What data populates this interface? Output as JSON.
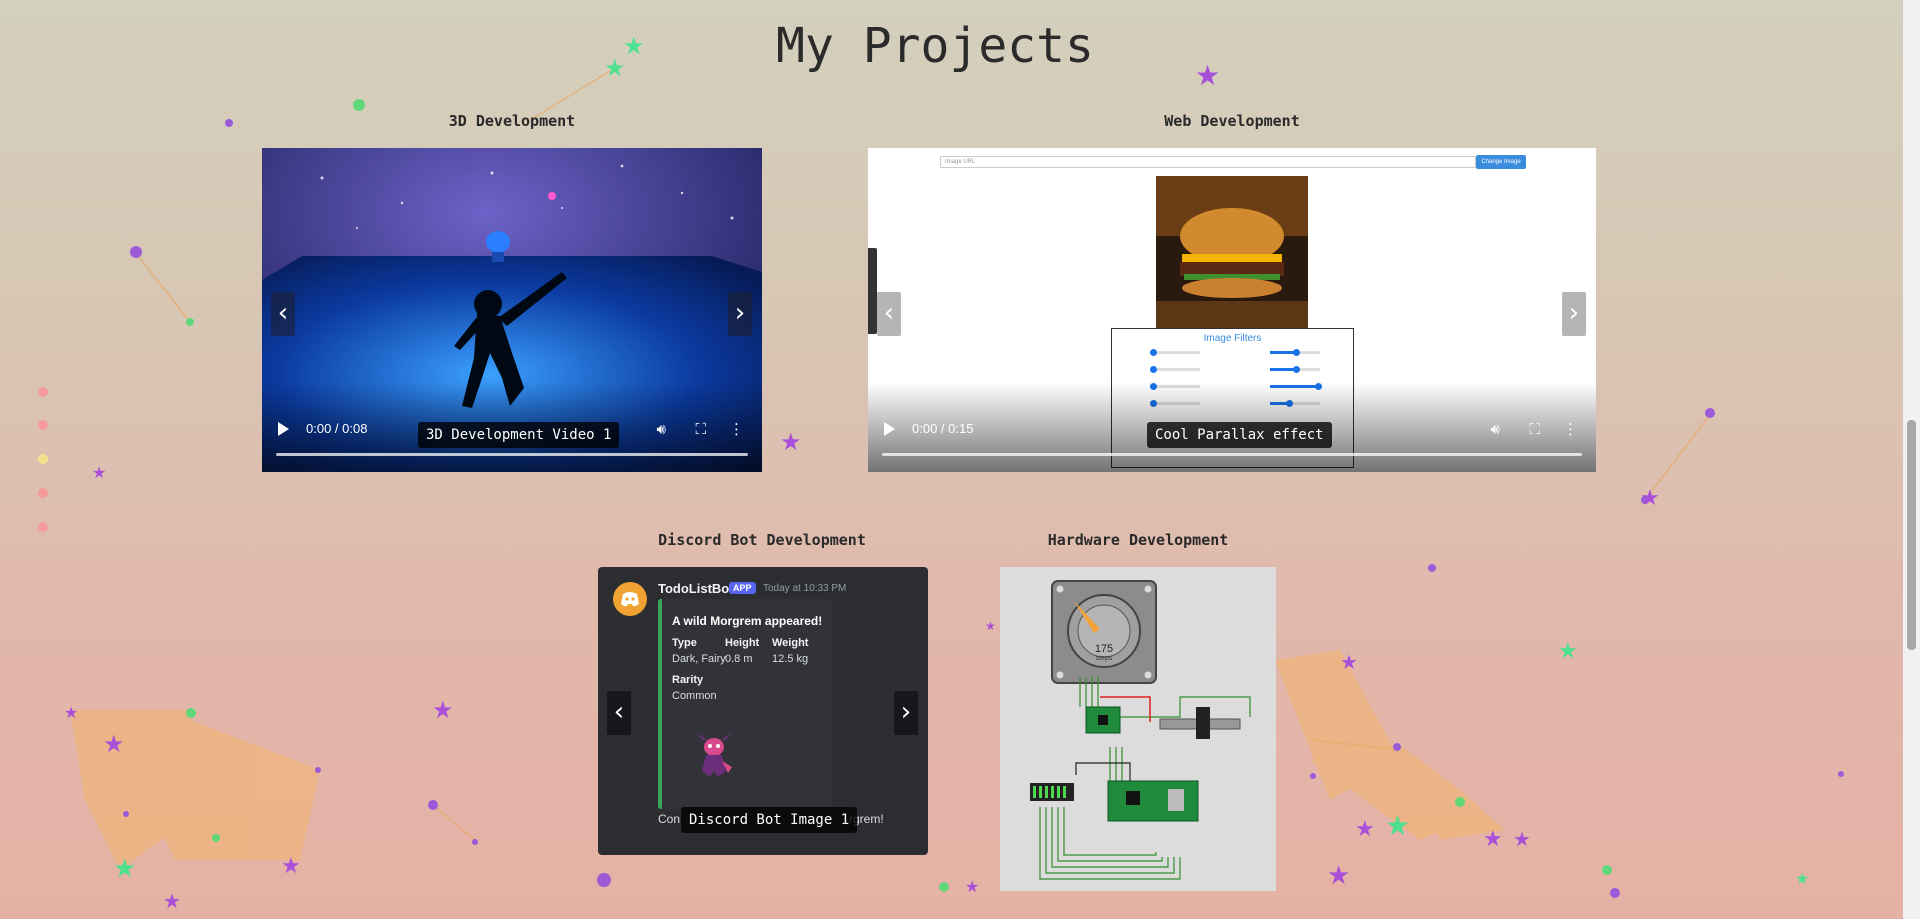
{
  "page": {
    "title": "My Projects"
  },
  "sections": {
    "dev3d": {
      "label": "3D Development",
      "caption": "3D Development Video 1",
      "time": "0:00 / 0:08"
    },
    "web": {
      "label": "Web Development",
      "caption": "Cool Parallax effect",
      "time": "0:00 / 0:15",
      "url_placeholder": "Image URL",
      "button": "Change Image",
      "filters_title": "Image Filters"
    },
    "discord": {
      "label": "Discord Bot Development",
      "caption": "Discord Bot Image 1",
      "bot_name": "TodoListBot",
      "bot_tag": "APP",
      "timestamp": "Today at 10:33 PM",
      "embed_title": "A wild Morgrem appeared!",
      "fields": {
        "type_label": "Type",
        "type_value": "Dark, Fairy",
        "height_label": "Height",
        "height_value": "0.8 m",
        "weight_label": "Weight",
        "weight_value": "12.5 kg",
        "rarity_label": "Rarity",
        "rarity_value": "Common"
      },
      "footer_left": "Con",
      "footer_right": "rgrem!"
    },
    "hardware": {
      "label": "Hardware Development",
      "stepper_value": "175",
      "stepper_unit": "steps"
    }
  },
  "controls": {
    "prev": "‹",
    "next": "›"
  },
  "colors": {
    "accent": "#3a8dde",
    "discord_green": "#3ba55d",
    "discord_blurple": "#5865f2"
  }
}
